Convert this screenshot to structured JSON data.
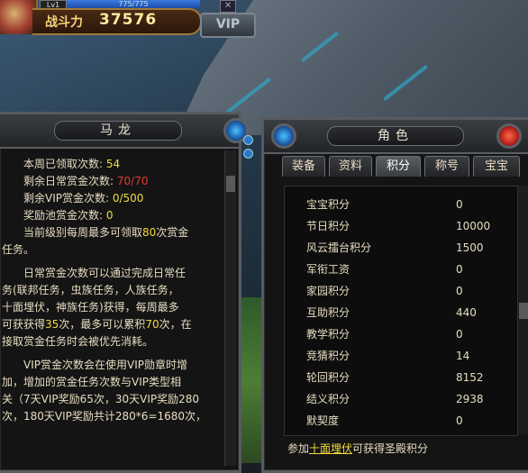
{
  "hud": {
    "level": "Lv1",
    "hp_text": "775/775",
    "power_label": "战斗力",
    "power_value": "37576",
    "vip_label": "VIP"
  },
  "left_panel": {
    "title": "马龙",
    "stats": [
      {
        "label": "本周已领取次数:",
        "value": "54",
        "color": "yellow"
      },
      {
        "label": "剩余日常赏金次数:",
        "value": "70/70",
        "color": "red"
      },
      {
        "label": "剩余VIP赏金次数:",
        "value": "0/500",
        "color": "yellow"
      },
      {
        "label": "奖励池赏金次数:",
        "value": "0",
        "color": "yellow"
      }
    ],
    "para1_a": "当前级别每周最多可领取",
    "para1_num": "80",
    "para1_b": "次赏金",
    "para1_line2": "任务。",
    "para2_l1": "日常赏金次数可以通过完成日常任",
    "para2_l2": "务(联邦任务，虫族任务，人族任务，",
    "para2_l3": "十面埋伏，神族任务)获得，每周最多",
    "para2_l4a": "可获获得",
    "para2_l4n1": "35",
    "para2_l4b": "次，最多可以累积",
    "para2_l4n2": "70",
    "para2_l4c": "次，在",
    "para2_l5": "接取赏金任务时会被优先消耗。",
    "para3_l1": "VIP赏金次数会在使用VIP勋章时增",
    "para3_l2": "加，增加的赏金任务次数与VIP类型相",
    "para3_l3": "关（7天VIP奖励65次，30天VIP奖励280",
    "para3_l4": "次，180天VIP奖励共计280*6=1680次，"
  },
  "right_panel": {
    "title": "角色",
    "tabs": [
      "装备",
      "资料",
      "积分",
      "称号",
      "宝宝"
    ],
    "active_tab": "积分",
    "rows": [
      {
        "name": "宝宝积分",
        "value": "0"
      },
      {
        "name": "节日积分",
        "value": "10000"
      },
      {
        "name": "风云擂台积分",
        "value": "1500"
      },
      {
        "name": "军衔工资",
        "value": "0"
      },
      {
        "name": "家园积分",
        "value": "0"
      },
      {
        "name": "互助积分",
        "value": "440"
      },
      {
        "name": "教学积分",
        "value": "0"
      },
      {
        "name": "竞猜积分",
        "value": "14"
      },
      {
        "name": "轮回积分",
        "value": "8152"
      },
      {
        "name": "结义积分",
        "value": "2938"
      },
      {
        "name": "默契度",
        "value": "0"
      }
    ],
    "hint_prefix": "参加",
    "hint_link": "十面埋伏",
    "hint_suffix": "可获得圣殿积分"
  }
}
